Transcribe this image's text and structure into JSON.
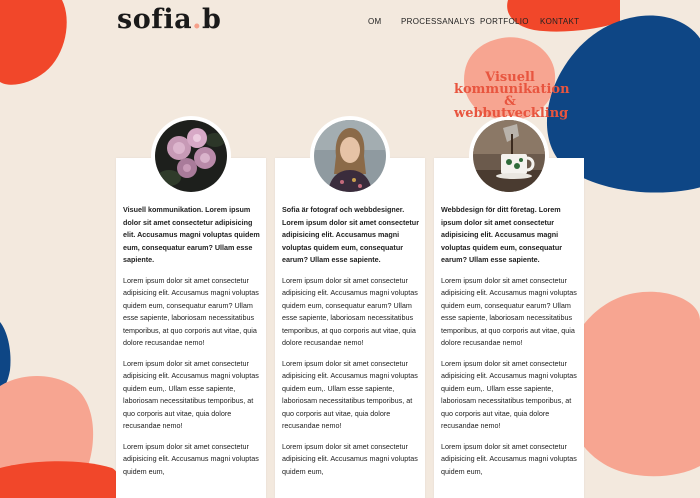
{
  "brand": {
    "logo_main": "sofia",
    "logo_dot": ".",
    "logo_end": "b"
  },
  "nav": {
    "items": [
      "OM",
      "PROCESSANALYS",
      "PORTFOLIO",
      "KONTAKT"
    ]
  },
  "hero": {
    "line1": "Visuell",
    "line2": "kommunikation",
    "line3": "& webbutveckling"
  },
  "cards": [
    {
      "image": "peony-flowers-photo",
      "lead": "Visuell kommunikation. Lorem ipsum dolor sit amet consectetur adipisicing elit. Accusamus magni voluptas quidem eum, consequatur earum? Ullam esse sapiente.",
      "para1": "Lorem ipsum dolor sit amet consectetur adipisicing elit. Accusamus magni voluptas quidem eum, consequatur earum? Ullam esse sapiente, laboriosam necessitatibus temporibus, at quo corporis aut vitae, quia dolore recusandae nemo!",
      "para2": "Lorem ipsum dolor sit amet consectetur adipisicing elit. Accusamus magni voluptas quidem eum,. Ullam esse sapiente, laboriosam necessitatibus temporibus, at quo corporis aut vitae, quia dolore recusandae nemo!",
      "para3": "Lorem ipsum dolor sit amet consectetur adipisicing elit. Accusamus magni voluptas quidem eum,"
    },
    {
      "image": "portrait-photo",
      "lead": "Sofia är fotograf och webbdesigner. Lorem ipsum dolor sit amet consectetur adipisicing elit. Accusamus magni voluptas quidem eum, consequatur earum? Ullam esse sapiente.",
      "para1": "Lorem ipsum dolor sit amet consectetur adipisicing elit. Accusamus magni voluptas quidem eum, consequatur earum? Ullam esse sapiente, laboriosam necessitatibus temporibus, at quo corporis aut vitae, quia dolore recusandae nemo!",
      "para2": "Lorem ipsum dolor sit amet consectetur adipisicing elit. Accusamus magni voluptas quidem eum,. Ullam esse sapiente, laboriosam necessitatibus temporibus, at quo corporis aut vitae, quia dolore recusandae nemo!",
      "para3": "Lorem ipsum dolor sit amet consectetur adipisicing elit. Accusamus magni voluptas quidem eum,"
    },
    {
      "image": "coffee-cup-photo",
      "lead": "Webbdesign för ditt företag. Lorem ipsum dolor sit amet consectetur adipisicing elit. Accusamus magni voluptas quidem eum, consequatur earum? Ullam esse sapiente.",
      "para1": "Lorem ipsum dolor sit amet consectetur adipisicing elit. Accusamus magni voluptas quidem eum, consequatur earum? Ullam esse sapiente, laboriosam necessitatibus temporibus, at quo corporis aut vitae, quia dolore recusandae nemo!",
      "para2": "Lorem ipsum dolor sit amet consectetur adipisicing elit. Accusamus magni voluptas quidem eum,. Ullam esse sapiente, laboriosam necessitatibus temporibus, at quo corporis aut vitae, quia dolore recusandae nemo!",
      "para3": "Lorem ipsum dolor sit amet consectetur adipisicing elit. Accusamus magni voluptas quidem eum,"
    }
  ],
  "colors": {
    "background": "#f3e9de",
    "blob_red": "#f1472a",
    "blob_blue": "#0e4685",
    "blob_peach": "#f7a591",
    "hero_text": "#e8553f",
    "logo_dot": "#f5a08a"
  }
}
